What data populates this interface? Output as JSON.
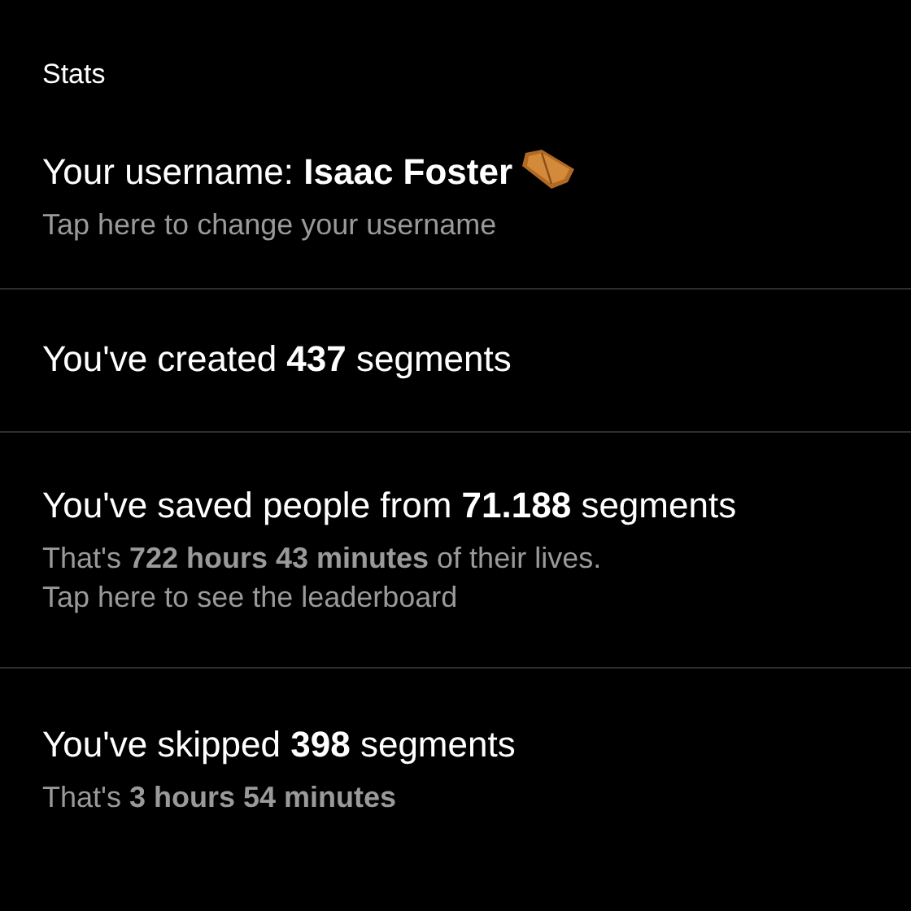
{
  "header": {
    "title": "Stats"
  },
  "items": [
    {
      "title": "Your username: **Isaac Foster**",
      "kind": "username",
      "lines": [
        "Tap here to change your username"
      ]
    },
    {
      "title": "You've created **437** segments",
      "kind": "plain"
    },
    {
      "title": "You've saved people from **71.188** segments",
      "kind": "plain",
      "lines": [
        "That's **722 hours 43 minutes** of their lives.",
        "Tap here to see the leaderboard"
      ]
    },
    {
      "title": "You've skipped **398** segments",
      "kind": "plain",
      "lines": [
        "That's **3 hours 54 minutes**"
      ]
    }
  ]
}
